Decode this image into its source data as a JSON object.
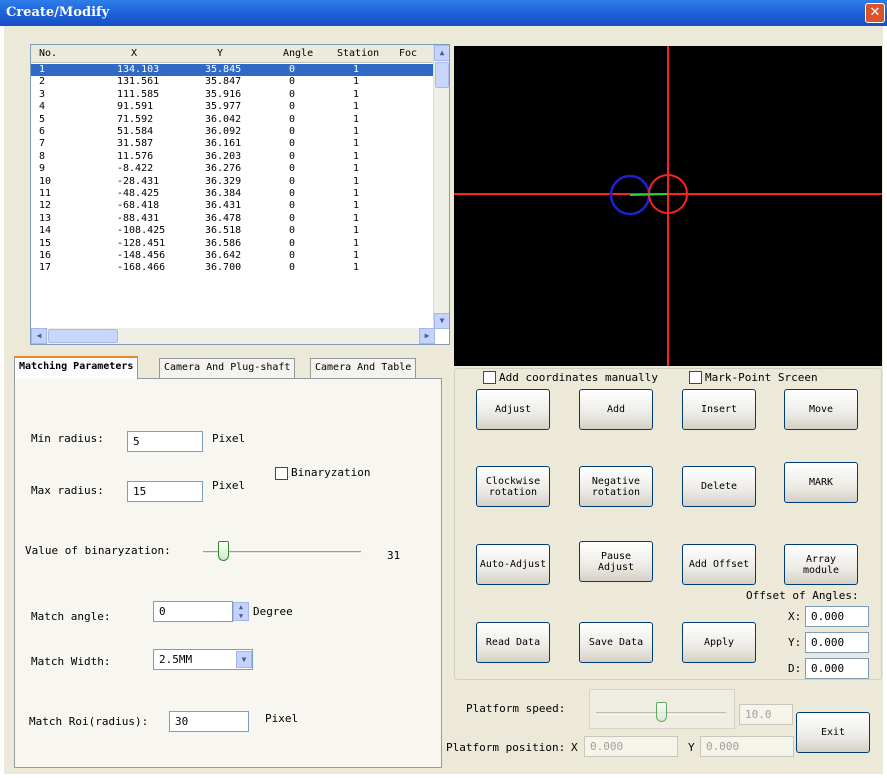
{
  "window": {
    "title": "Create/Modify",
    "close": "✕"
  },
  "list": {
    "columns": [
      "No.",
      "X",
      "Y",
      "Angle",
      "Station",
      "Foc"
    ],
    "rows": [
      [
        "1",
        "134.103",
        "35.845",
        "0",
        "1"
      ],
      [
        "2",
        "131.561",
        "35.847",
        "0",
        "1"
      ],
      [
        "3",
        "111.585",
        "35.916",
        "0",
        "1"
      ],
      [
        "4",
        "91.591",
        "35.977",
        "0",
        "1"
      ],
      [
        "5",
        "71.592",
        "36.042",
        "0",
        "1"
      ],
      [
        "6",
        "51.584",
        "36.092",
        "0",
        "1"
      ],
      [
        "7",
        "31.587",
        "36.161",
        "0",
        "1"
      ],
      [
        "8",
        "11.576",
        "36.203",
        "0",
        "1"
      ],
      [
        "9",
        "-8.422",
        "36.276",
        "0",
        "1"
      ],
      [
        "10",
        "-28.431",
        "36.329",
        "0",
        "1"
      ],
      [
        "11",
        "-48.425",
        "36.384",
        "0",
        "1"
      ],
      [
        "12",
        "-68.418",
        "36.431",
        "0",
        "1"
      ],
      [
        "13",
        "-88.431",
        "36.478",
        "0",
        "1"
      ],
      [
        "14",
        "-108.425",
        "36.518",
        "0",
        "1"
      ],
      [
        "15",
        "-128.451",
        "36.586",
        "0",
        "1"
      ],
      [
        "16",
        "-148.456",
        "36.642",
        "0",
        "1"
      ],
      [
        "17",
        "-168.466",
        "36.700",
        "0",
        "1"
      ]
    ],
    "selected_row": 0
  },
  "tabs": [
    "Matching Parameters",
    "Camera And Plug-shaft",
    "Camera And Table"
  ],
  "matching": {
    "min_radius_label": "Min radius:",
    "min_radius_value": "5",
    "min_radius_unit": "Pixel",
    "max_radius_label": "Max radius:",
    "max_radius_value": "15",
    "max_radius_unit": "Pixel",
    "binaryzation_label": "Binaryzation",
    "binaryzation_value_label": "Value of binaryzation:",
    "binaryzation_value": "31",
    "match_angle_label": "Match angle:",
    "match_angle_value": "0",
    "match_angle_unit": "Degree",
    "match_width_label": "Match Width:",
    "match_width_value": "2.5MM",
    "match_roi_label": "Match Roi(radius):",
    "match_roi_value": "30",
    "match_roi_unit": "Pixel"
  },
  "controls": {
    "add_manually": "Add coordinates manually",
    "mark_point_screen": "Mark-Point Srceen",
    "buttons": {
      "adjust": "Adjust",
      "add": "Add",
      "insert": "Insert",
      "move": "Move",
      "clockwise": "Clockwise rotation",
      "negative": "Negative rotation",
      "delete": "Delete",
      "mark": "MARK",
      "auto_adjust": "Auto-Adjust",
      "pause_adjust": "Pause Adjust",
      "add_offset": "Add Offset",
      "array_module": "Array module",
      "read_data": "Read Data",
      "save_data": "Save Data",
      "apply": "Apply",
      "exit": "Exit"
    },
    "offset_title": "Offset of Angles:",
    "offset_x_label": "X:",
    "offset_x": "0.000",
    "offset_y_label": "Y:",
    "offset_y": "0.000",
    "offset_d_label": "D:",
    "offset_d": "0.000"
  },
  "platform": {
    "speed_label": "Platform speed:",
    "speed_value": "10.0",
    "position_label": "Platform position:",
    "x_label": "X",
    "x_value": "0.000",
    "y_label": "Y",
    "y_value": "0.000"
  },
  "colors": {
    "titlebar": "#1b5fd6",
    "selection": "#316ac5",
    "crosshair": "#ff2020",
    "circle_blue": "#2020d0"
  },
  "icons": {
    "close": "close-icon",
    "scroll_up": "arrow-up-icon",
    "scroll_down": "arrow-down-icon",
    "scroll_left": "arrow-left-icon",
    "scroll_right": "arrow-right-icon",
    "dropdown": "chevron-down-icon",
    "spin": "spin-arrows-icon"
  }
}
